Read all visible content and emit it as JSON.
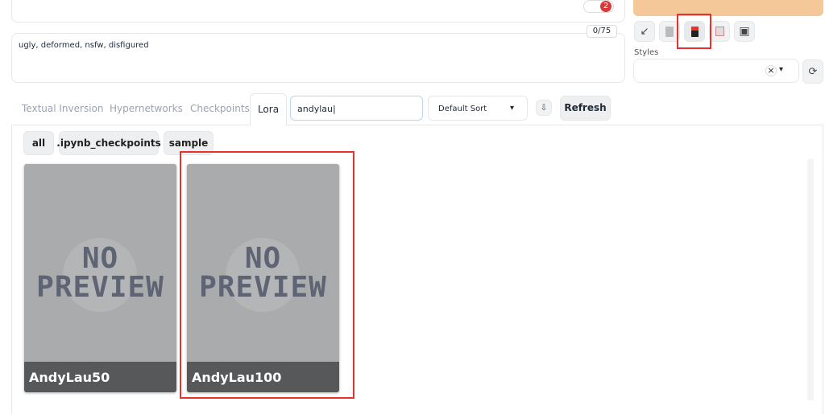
{
  "prompt_box": {
    "badge": "2"
  },
  "negative_prompt": {
    "value": "ugly, deformed, nsfw, disfigured",
    "token_count": "0/75"
  },
  "toolbar": {
    "icons": [
      "arrow-down-left-icon",
      "trash-icon",
      "extra-networks-icon",
      "clipboard-icon",
      "save-icon"
    ]
  },
  "styles": {
    "label": "Styles",
    "clear": "×",
    "arrow": "▾"
  },
  "tabs": [
    {
      "label": "Textual Inversion"
    },
    {
      "label": "Hypernetworks"
    },
    {
      "label": "Checkpoints"
    },
    {
      "label": "Lora",
      "active": true
    }
  ],
  "search": {
    "value": "andylau"
  },
  "sort": {
    "value": "Default Sort",
    "arrow": "▾"
  },
  "refresh_label": "Refresh",
  "filters": [
    {
      "label": "all"
    },
    {
      "label": ".ipynb_checkpoints"
    },
    {
      "label": "sample"
    }
  ],
  "cards": [
    {
      "name": "AndyLau50",
      "preview": "NO PREVIEW"
    },
    {
      "name": "AndyLau100",
      "preview": "NO PREVIEW"
    }
  ],
  "colors": {
    "highlight": "#e5322d",
    "progress": "#f5c89a",
    "badge": "#d63a3a"
  }
}
